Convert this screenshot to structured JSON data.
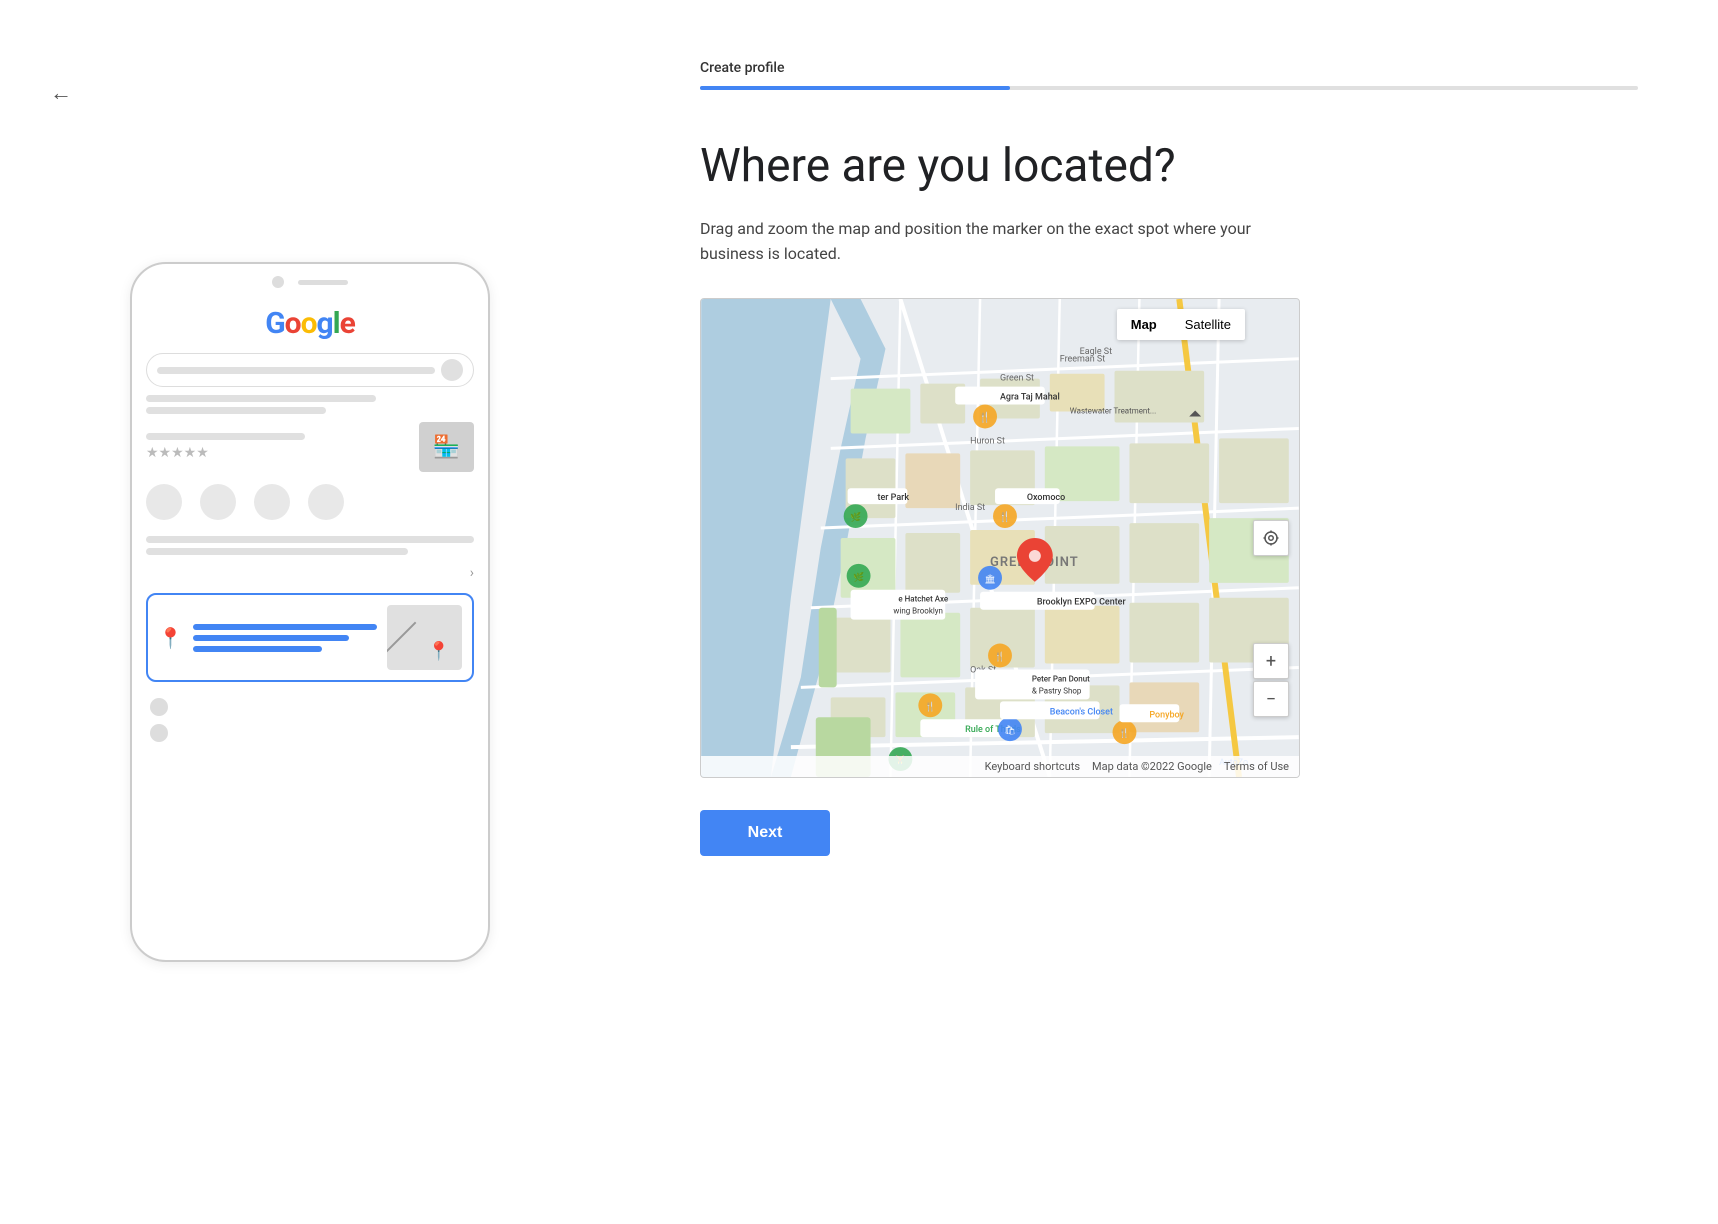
{
  "page": {
    "title": "Where are you located?",
    "description": "Drag and zoom the map and position the marker on the exact spot where your business is located.",
    "progress_label": "Create profile",
    "progress_percent": 33
  },
  "header": {
    "back_label": "←"
  },
  "map": {
    "type_buttons": [
      "Map",
      "Satellite"
    ],
    "active_type": "Map",
    "footer": {
      "keyboard": "Keyboard shortcuts",
      "data": "Map data ©2022 Google",
      "terms": "Terms of Use"
    },
    "zoom_in": "+",
    "zoom_out": "−",
    "location_icon": "⊕"
  },
  "next_button": {
    "label": "Next"
  },
  "phone": {
    "google_logo": "Google",
    "pin_icon": "📍",
    "map_pin_card": "📍"
  }
}
